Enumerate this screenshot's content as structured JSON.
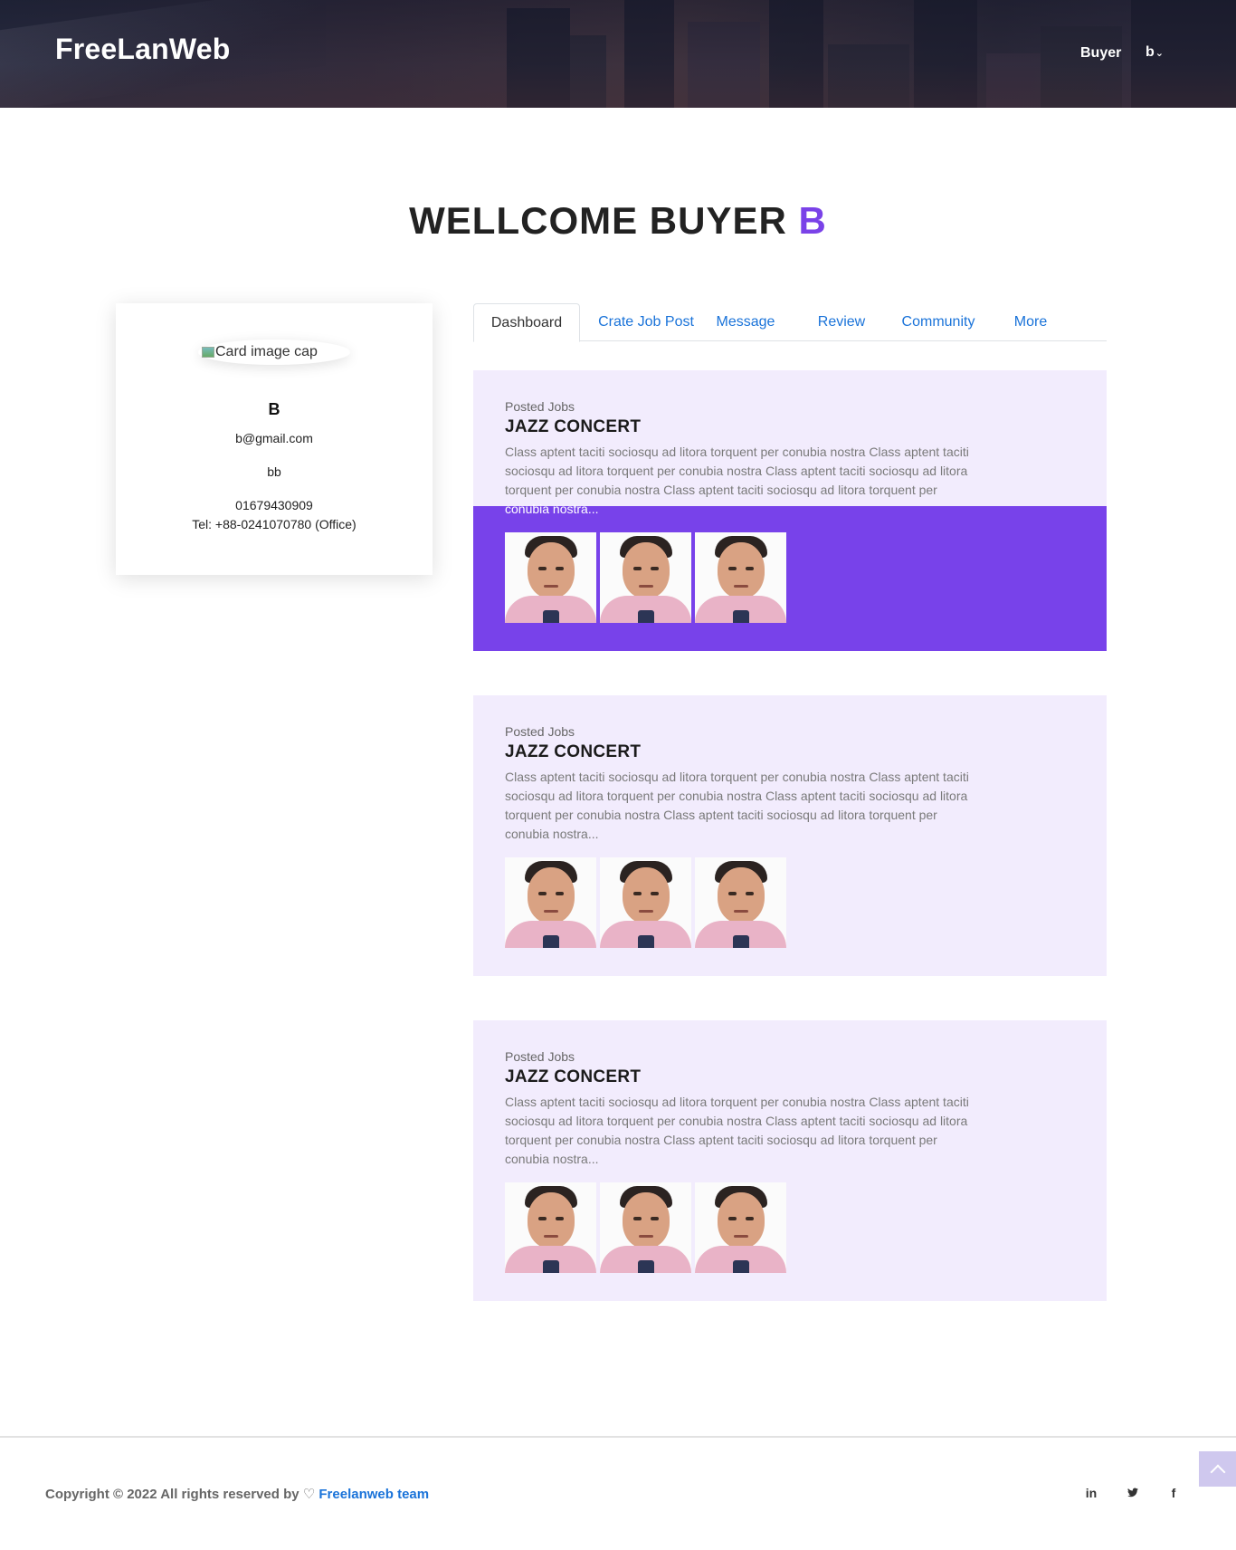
{
  "header": {
    "brand": "FreeLanWeb",
    "nav": {
      "buyer_label": "Buyer",
      "user_label": "b"
    }
  },
  "welcome": {
    "prefix": "WELLCOME BUYER",
    "name": "B"
  },
  "profile": {
    "image_alt": "Card image cap",
    "name": "B",
    "email": "b@gmail.com",
    "field": "bb",
    "phone": "01679430909",
    "tel": "Tel: +88-0241070780 (Office)"
  },
  "tabs": [
    {
      "label": "Dashboard",
      "active": true
    },
    {
      "label": "Crate Job Post",
      "active": false
    },
    {
      "label": "Message",
      "active": false
    },
    {
      "label": "Review",
      "active": false
    },
    {
      "label": "Community",
      "active": false
    },
    {
      "label": "More",
      "active": false
    }
  ],
  "jobs": [
    {
      "label": "Posted Jobs",
      "title": "JAZZ CONCERT",
      "desc_lines": [
        "Class aptent taciti sociosqu ad litora torquent per conubia nostra Class aptent taciti",
        "sociosqu ad litora torquent per conubia nostra Class aptent taciti sociosqu ad litora",
        "torquent per conubia nostra Class aptent taciti sociosqu ad litora torquent per",
        "conubia nostra..."
      ],
      "highlighted": true
    },
    {
      "label": "Posted Jobs",
      "title": "JAZZ CONCERT",
      "desc_lines": [
        "Class aptent taciti sociosqu ad litora torquent per conubia nostra Class aptent taciti",
        "sociosqu ad litora torquent per conubia nostra Class aptent taciti sociosqu ad litora",
        "torquent per conubia nostra Class aptent taciti sociosqu ad litora torquent per",
        "conubia nostra..."
      ],
      "highlighted": false
    },
    {
      "label": "Posted Jobs",
      "title": "JAZZ CONCERT",
      "desc_lines": [
        "Class aptent taciti sociosqu ad litora torquent per conubia nostra Class aptent taciti",
        "sociosqu ad litora torquent per conubia nostra Class aptent taciti sociosqu ad litora",
        "torquent per conubia nostra Class aptent taciti sociosqu ad litora torquent per",
        "conubia nostra..."
      ],
      "highlighted": false
    }
  ],
  "footer": {
    "copyright": "Copyright © 2022 All rights reserved by",
    "heart_icon": "heart-icon",
    "team": "Freelanweb team",
    "social": {
      "linkedin": "in",
      "twitter_icon": "twitter-icon",
      "facebook": "f"
    },
    "back_to_top_icon": "chevron-up-icon"
  },
  "colors": {
    "accent": "#7842ea",
    "card_bg": "#f2ecfd",
    "link": "#1a73d9"
  }
}
